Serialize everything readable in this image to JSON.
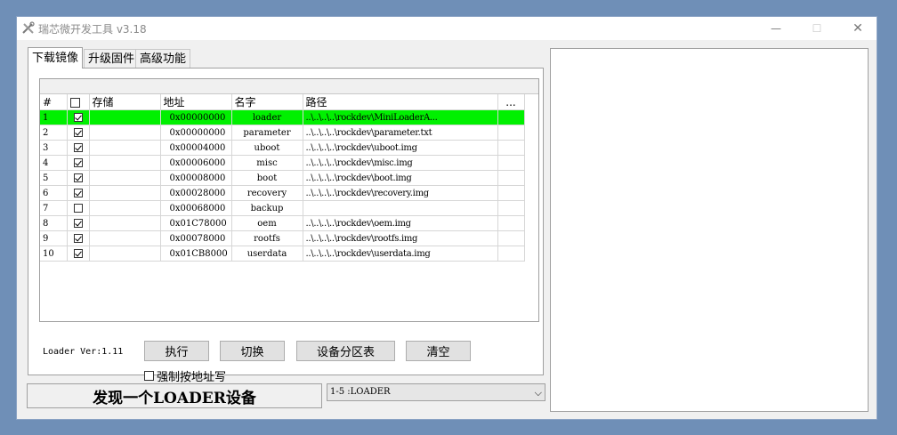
{
  "window": {
    "title": "瑞芯微开发工具 v3.18",
    "minimize": "—",
    "maximize": "☐",
    "close": "✕"
  },
  "tabs": [
    {
      "label": "下载镜像",
      "active": true
    },
    {
      "label": "升级固件",
      "active": false
    },
    {
      "label": "高级功能",
      "active": false
    }
  ],
  "table": {
    "headers": {
      "index": "#",
      "storage": "存储",
      "address": "地址",
      "name": "名字",
      "path": "路径",
      "more": "..."
    },
    "rows": [
      {
        "index": "1",
        "checked": true,
        "storage": "",
        "address": "0x00000000",
        "name": "loader",
        "path": "..\\..\\..\\..\\rockdev\\MiniLoaderA...",
        "selected": true
      },
      {
        "index": "2",
        "checked": true,
        "storage": "",
        "address": "0x00000000",
        "name": "parameter",
        "path": "..\\..\\..\\..\\rockdev\\parameter.txt",
        "selected": false
      },
      {
        "index": "3",
        "checked": true,
        "storage": "",
        "address": "0x00004000",
        "name": "uboot",
        "path": "..\\..\\..\\..\\rockdev\\uboot.img",
        "selected": false
      },
      {
        "index": "4",
        "checked": true,
        "storage": "",
        "address": "0x00006000",
        "name": "misc",
        "path": "..\\..\\..\\..\\rockdev\\misc.img",
        "selected": false
      },
      {
        "index": "5",
        "checked": true,
        "storage": "",
        "address": "0x00008000",
        "name": "boot",
        "path": "..\\..\\..\\..\\rockdev\\boot.img",
        "selected": false
      },
      {
        "index": "6",
        "checked": true,
        "storage": "",
        "address": "0x00028000",
        "name": "recovery",
        "path": "..\\..\\..\\..\\rockdev\\recovery.img",
        "selected": false
      },
      {
        "index": "7",
        "checked": false,
        "storage": "",
        "address": "0x00068000",
        "name": "backup",
        "path": "",
        "selected": false
      },
      {
        "index": "8",
        "checked": true,
        "storage": "",
        "address": "0x01C78000",
        "name": "oem",
        "path": "..\\..\\..\\..\\rockdev\\oem.img",
        "selected": false
      },
      {
        "index": "9",
        "checked": true,
        "storage": "",
        "address": "0x00078000",
        "name": "rootfs",
        "path": "..\\..\\..\\..\\rockdev\\rootfs.img",
        "selected": false
      },
      {
        "index": "10",
        "checked": true,
        "storage": "",
        "address": "0x01CB8000",
        "name": "userdata",
        "path": "..\\..\\..\\..\\rockdev\\userdata.img",
        "selected": false
      }
    ]
  },
  "loader_version": "Loader Ver:1.11",
  "buttons": {
    "run": "执行",
    "switch": "切换",
    "partition": "设备分区表",
    "clear": "清空"
  },
  "force_address_label": "强制按地址写",
  "status_text": "发现一个LOADER设备",
  "device_select": {
    "value": "1-5 :LOADER"
  },
  "colors": {
    "selected_row": "#00f000",
    "desktop": "#6f8fb7"
  }
}
